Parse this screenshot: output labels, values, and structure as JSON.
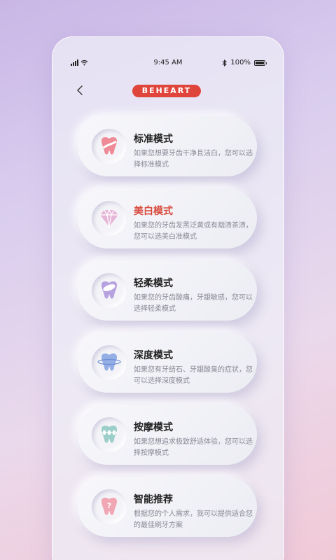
{
  "status": {
    "time": "9:45 AM",
    "battery": "100%",
    "battery_level": 1.0
  },
  "header": {
    "back_icon": "chevron-left-icon",
    "brand": "BEHEART"
  },
  "modes": [
    {
      "title": "标准模式",
      "desc": "如果您想要牙齿干净且洁白，您可以选择标准模式",
      "icon": "tooth-standard-icon",
      "color": "#ef8b96",
      "active": false
    },
    {
      "title": "美白模式",
      "desc": "如果您的牙齿发黑泛黄或有烟渍茶渍，您可以选美白准模式",
      "icon": "diamond-icon",
      "color": "#e6b6d8",
      "active": true
    },
    {
      "title": "轻柔模式",
      "desc": "如果您的牙齿酸痛，牙龈敏感，您可以选择轻柔模式",
      "icon": "tooth-gentle-icon",
      "color": "#b7a2e0",
      "active": false
    },
    {
      "title": "深度模式",
      "desc": "如果您有牙结石、牙龈酸臭的症状，您可以选择深度模式",
      "icon": "tooth-deep-icon",
      "color": "#94aee6",
      "active": false
    },
    {
      "title": "按摩模式",
      "desc": "如果您想追求极致舒适体验，您可以选择按摩模式",
      "icon": "tooth-massage-icon",
      "color": "#9ccfc9",
      "active": false
    },
    {
      "title": "智能推荐",
      "desc": "根据您的个人需求，我可以提供适合您的最佳刷牙方案",
      "icon": "tooth-question-icon",
      "color": "#f1a6b3",
      "active": false
    }
  ]
}
